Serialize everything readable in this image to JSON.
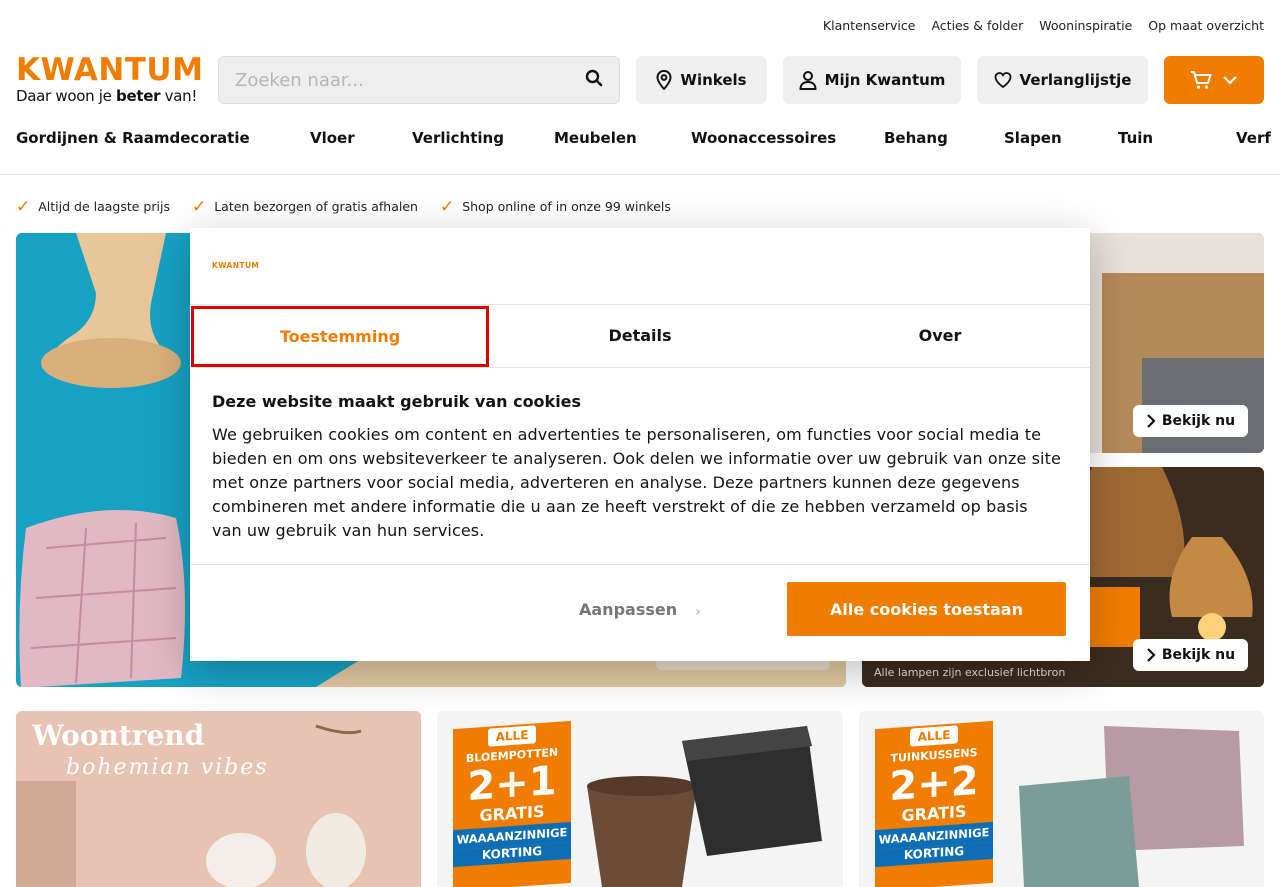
{
  "top_links": [
    "Klantenservice",
    "Acties & folder",
    "Wooninspiratie",
    "Op maat overzicht"
  ],
  "logo": {
    "word": "KWANTUM",
    "tagline_pre": "Daar woon je ",
    "tagline_bold": "beter",
    "tagline_post": " van!"
  },
  "search": {
    "placeholder": "Zoeken naar..."
  },
  "header_buttons": {
    "stores": "Winkels",
    "account": "Mijn Kwantum",
    "wishlist": "Verlanglijstje"
  },
  "nav": [
    "Gordijnen & Raamdecoratie",
    "Vloer",
    "Verlichting",
    "Meubelen",
    "Woonaccessoires",
    "Behang",
    "Slapen",
    "Tuin",
    "Verf"
  ],
  "usps": [
    "Altijd de laagste prijs",
    "Laten bezorgen of gratis afhalen",
    "Shop online of in onze 99 winkels"
  ],
  "promo": {
    "bekijk_label": "Bekijk nu",
    "lamp_note": "Alle lampen zijn exclusief lichtbron",
    "trend_title": "Woontrend",
    "trend_sub": "bohemian vibes",
    "pots": {
      "alle": "ALLE",
      "cat": "BLOEMPOTTEN",
      "deal": "2+1",
      "gratis": "GRATIS",
      "wa": "WAAAANZINNIGE",
      "korting": "KORTING"
    },
    "cushions": {
      "alle": "ALLE",
      "cat": "TUINKUSSENS",
      "deal": "2+2",
      "gratis": "GRATIS",
      "wa": "WAAAANZINNIGE",
      "korting": "KORTING"
    }
  },
  "cookie_dialog": {
    "logo": "KWANTUM",
    "tabs": [
      "Toestemming",
      "Details",
      "Over"
    ],
    "heading": "Deze website maakt gebruik van cookies",
    "body": "We gebruiken cookies om content en advertenties te personaliseren, om functies voor social media te bieden en om ons websiteverkeer te analyseren. Ook delen we informatie over uw gebruik van onze site met onze partners voor social media, adverteren en analyse. Deze partners kunnen deze gegevens combineren met andere informatie die u aan ze heeft verstrekt of die ze hebben verzameld op basis van uw gebruik van hun services.",
    "customize_label": "Aanpassen",
    "allow_all_label": "Alle cookies toestaan"
  },
  "colors": {
    "brand": "#f07d00",
    "highlight": "#e10000"
  }
}
